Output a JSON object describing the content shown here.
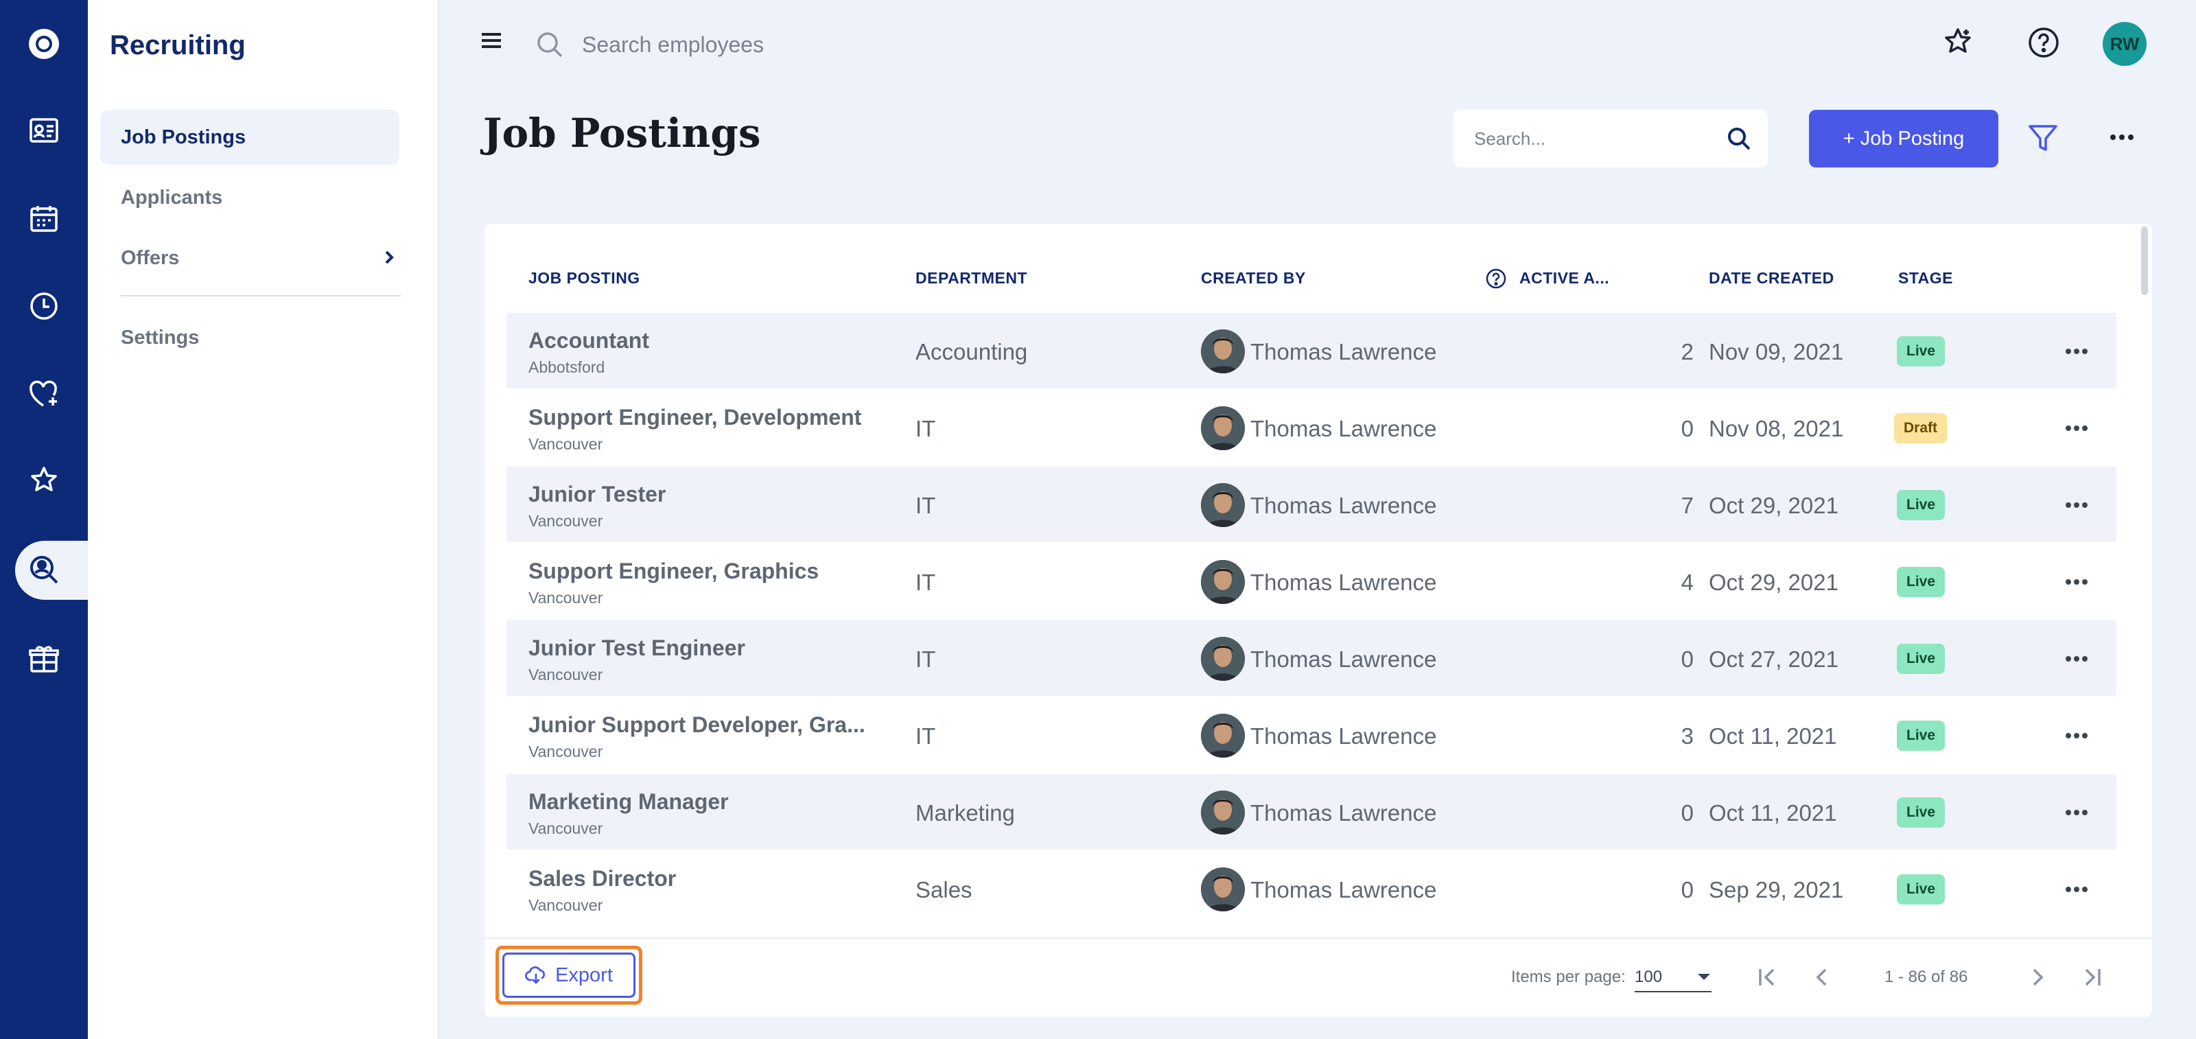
{
  "rail": {
    "icons": [
      "logo-icon",
      "id-card-icon",
      "calendar-icon",
      "clock-icon",
      "heart-plus-icon",
      "star-icon",
      "recruiting-search-icon",
      "gift-box-icon"
    ],
    "active": "recruiting-search-icon",
    "color": "#0d2a78"
  },
  "subnav": {
    "title": "Recruiting",
    "items": [
      {
        "label": "Job Postings",
        "active": true
      },
      {
        "label": "Applicants",
        "active": false
      },
      {
        "label": "Offers",
        "active": false,
        "has_children": true
      },
      {
        "label": "Settings",
        "active": false
      }
    ]
  },
  "topbar": {
    "search_placeholder": "Search employees",
    "user_initials": "RW",
    "avatar_color": "#179a98"
  },
  "page": {
    "title": "Job Postings",
    "search_placeholder": "Search...",
    "add_button": "+ Job Posting",
    "accent": "#4a58e8"
  },
  "table": {
    "headers": {
      "job_posting": "JOB POSTING",
      "department": "DEPARTMENT",
      "created_by": "CREATED BY",
      "active": "ACTIVE A...",
      "date_created": "DATE CREATED",
      "stage": "STAGE"
    },
    "rows": [
      {
        "title": "Accountant",
        "location": "Abbotsford",
        "department": "Accounting",
        "created_by": "Thomas Lawrence",
        "active": "2",
        "date": "Nov 09, 2021",
        "stage": "Live"
      },
      {
        "title": "Support Engineer, Development",
        "location": "Vancouver",
        "department": "IT",
        "created_by": "Thomas Lawrence",
        "active": "0",
        "date": "Nov 08, 2021",
        "stage": "Draft"
      },
      {
        "title": "Junior Tester",
        "location": "Vancouver",
        "department": "IT",
        "created_by": "Thomas Lawrence",
        "active": "7",
        "date": "Oct 29, 2021",
        "stage": "Live"
      },
      {
        "title": "Support Engineer, Graphics",
        "location": "Vancouver",
        "department": "IT",
        "created_by": "Thomas Lawrence",
        "active": "4",
        "date": "Oct 29, 2021",
        "stage": "Live"
      },
      {
        "title": "Junior Test Engineer",
        "location": "Vancouver",
        "department": "IT",
        "created_by": "Thomas Lawrence",
        "active": "0",
        "date": "Oct 27, 2021",
        "stage": "Live"
      },
      {
        "title": "Junior Support Developer, Gra...",
        "location": "Vancouver",
        "department": "IT",
        "created_by": "Thomas Lawrence",
        "active": "3",
        "date": "Oct 11, 2021",
        "stage": "Live"
      },
      {
        "title": "Marketing Manager",
        "location": "Vancouver",
        "department": "Marketing",
        "created_by": "Thomas Lawrence",
        "active": "0",
        "date": "Oct 11, 2021",
        "stage": "Live"
      },
      {
        "title": "Sales Director",
        "location": "Vancouver",
        "department": "Sales",
        "created_by": "Thomas Lawrence",
        "active": "0",
        "date": "Sep 29, 2021",
        "stage": "Live"
      }
    ],
    "stage_colors": {
      "Live": "#8ce6bf",
      "Draft": "#fce29a"
    }
  },
  "footer": {
    "export_label": "Export",
    "items_per_page_label": "Items per page:",
    "items_per_page_value": "100",
    "range": "1 - 86 of 86"
  }
}
